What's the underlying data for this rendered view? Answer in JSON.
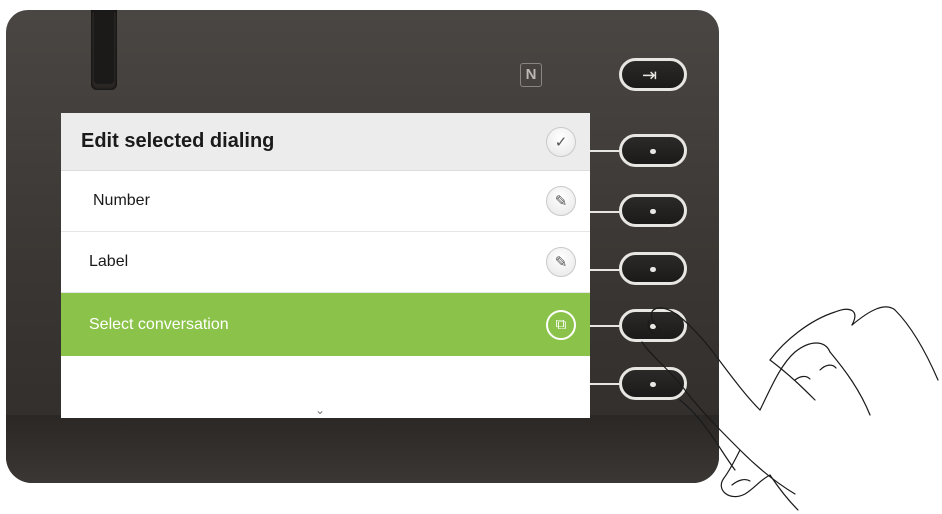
{
  "screen": {
    "title": "Edit selected dialing",
    "title_icon": "checkmark-icon",
    "items": [
      {
        "label": "Number",
        "icon": "pencil-icon",
        "selected": false
      },
      {
        "label": "Label",
        "icon": "pencil-icon",
        "selected": false
      },
      {
        "label": "Select conversation",
        "icon": "conversation-icon",
        "selected": true
      }
    ],
    "scroll_indicator": "⌄"
  },
  "hardware": {
    "exit_icon": "exit-icon",
    "nfc_icon": "nfc-icon",
    "nfc_symbol": "N"
  },
  "colors": {
    "selected_row": "#8bc34a",
    "device_body": "#3a3633",
    "title_bar": "#ececec"
  }
}
